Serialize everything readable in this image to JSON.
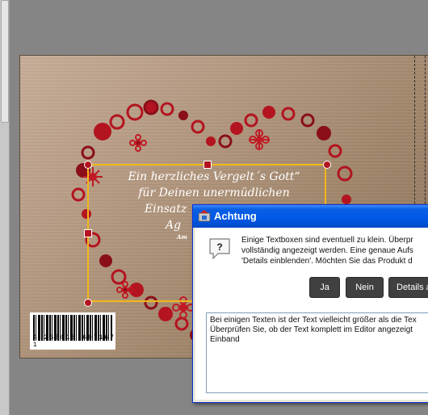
{
  "dialog": {
    "title": "Achtung",
    "message_lines": [
      "Einige Textboxen sind eventuell zu klein. Überpr",
      "vollständig angezeigt werden. Eine genaue Aufs",
      "'Details einblenden'.  Möchten Sie das Produkt d"
    ],
    "buttons": {
      "yes": "Ja",
      "no": "Nein",
      "details": "Details a"
    },
    "details_lines": [
      "Bei einigen Texten ist der Text vielleicht größer als die Tex",
      "Überprüfen Sie, ob der Text komplett im Editor angezeigt",
      "Einband"
    ]
  },
  "card": {
    "text_lines": [
      "Ein herzliches Vergelt´s Gott“",
      "für Deinen unermüdlichen",
      "Einsatz",
      "Ag"
    ],
    "small_text": "Am",
    "barcode_number": "4 260018 697167 1"
  },
  "colors": {
    "accent_red": "#b3141f",
    "selection_border": "#f3b619",
    "titlebar_blue": "#0058e6",
    "button_dark": "#404040"
  }
}
